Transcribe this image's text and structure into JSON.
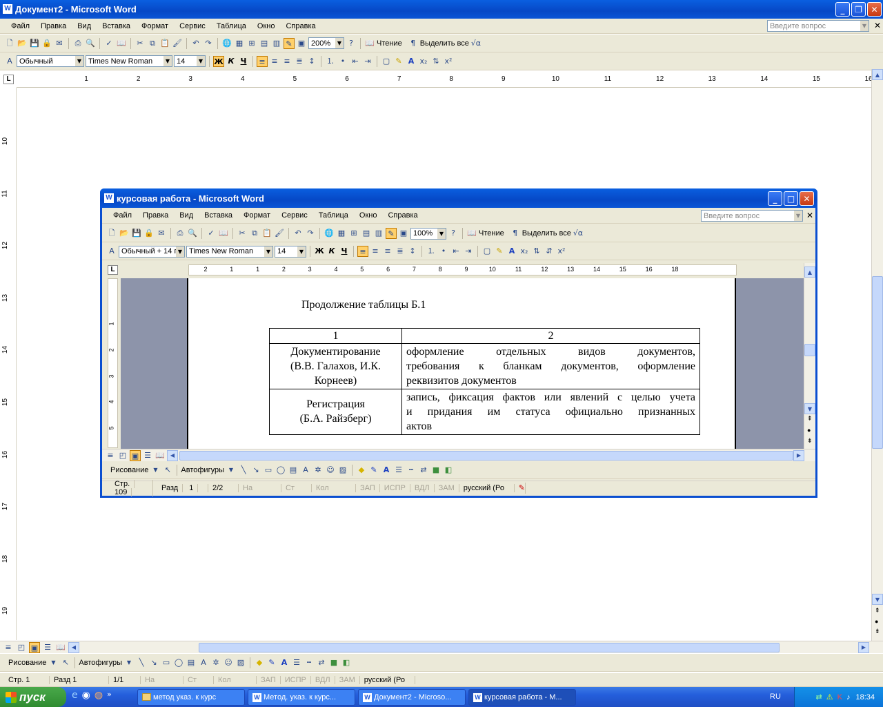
{
  "outer": {
    "title": "Документ2 - Microsoft Word",
    "menu": [
      "Файл",
      "Правка",
      "Вид",
      "Вставка",
      "Формат",
      "Сервис",
      "Таблица",
      "Окно",
      "Справка"
    ],
    "ask_placeholder": "Введите вопрос",
    "zoom": "200%",
    "reading": "Чтение",
    "select_all": "Выделить все",
    "style": "Обычный",
    "font": "Times New Roman",
    "size": "14",
    "bold": "Ж",
    "italic": "К",
    "underline": "Ч",
    "ruler_ticks": [
      "1",
      "2",
      "3",
      "4",
      "5",
      "6",
      "7",
      "8",
      "9",
      "10",
      "11",
      "12",
      "13",
      "14",
      "15",
      "16"
    ],
    "vruler_ticks": [
      "10",
      "11",
      "12",
      "13",
      "14",
      "15",
      "16",
      "17",
      "18",
      "19"
    ],
    "drawing": "Рисование",
    "autoshapes": "Автофигуры",
    "status": {
      "page": "Стр. 1",
      "section": "Разд 1",
      "pages": "1/1",
      "at": "На",
      "line": "Ст",
      "col": "Кол",
      "rec": "ЗАП",
      "trk": "ИСПР",
      "ext": "ВДЛ",
      "ovr": "ЗАМ",
      "lang": "русский (Ро"
    }
  },
  "inner": {
    "title": "курсовая работа - Microsoft Word",
    "menu": [
      "Файл",
      "Правка",
      "Вид",
      "Вставка",
      "Формат",
      "Сервис",
      "Таблица",
      "Окно",
      "Справка"
    ],
    "ask_placeholder": "Введите вопрос",
    "zoom": "100%",
    "reading": "Чтение",
    "select_all": "Выделить все",
    "style": "Обычный + 14 г",
    "font": "Times New Roman",
    "size": "14",
    "bold": "Ж",
    "italic": "К",
    "underline": "Ч",
    "ruler_ticks": [
      "2",
      "1",
      "1",
      "2",
      "3",
      "4",
      "5",
      "6",
      "7",
      "8",
      "9",
      "10",
      "11",
      "12",
      "13",
      "14",
      "15",
      "16",
      "18"
    ],
    "vruler_ticks": [
      "1",
      "2",
      "3",
      "4",
      "5"
    ],
    "drawing": "Рисование",
    "autoshapes": "Автофигуры",
    "status": {
      "page": "Стр.",
      "page_num": "109",
      "section": "Разд",
      "section_num": "1",
      "pages": "2/2",
      "at": "На",
      "line": "Ст",
      "col": "Кол",
      "rec": "ЗАП",
      "trk": "ИСПР",
      "ext": "ВДЛ",
      "ovr": "ЗАМ",
      "lang": "русский (Ро"
    }
  },
  "document": {
    "heading": "Продолжение таблицы Б.1",
    "header_cells": [
      "1",
      "2"
    ],
    "rows": [
      {
        "term": [
          "Документирование",
          "(В.В. Галахов, И.К.",
          "Корнеев)"
        ],
        "definition": [
          "оформление отдельных видов документов,",
          "требования к бланкам документов, оформление",
          "реквизитов документов"
        ]
      },
      {
        "term": [
          "Регистрация",
          "(Б.А. Райзберг)"
        ],
        "definition": [
          "запись, фиксация фактов или явлений с целью учета",
          "и придания им статуса официально признанных",
          "актов"
        ]
      }
    ]
  },
  "taskbar": {
    "start": "пуск",
    "tasks": [
      "метод указ. к курс",
      "Метод. указ. к курс...",
      "Документ2 - Microso...",
      "курсовая работа - М..."
    ],
    "lang": "RU",
    "time": "18:34"
  }
}
